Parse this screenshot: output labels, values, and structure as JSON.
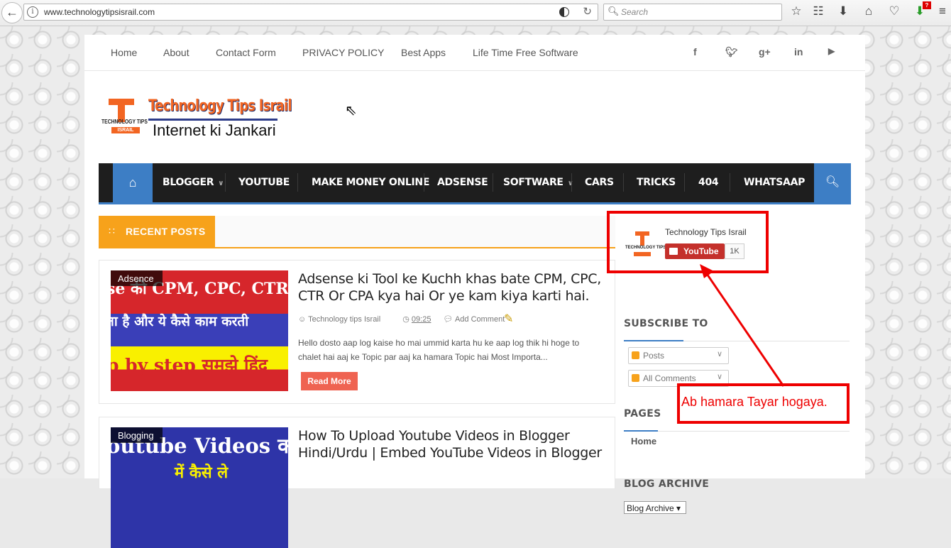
{
  "browser": {
    "url": "www.technologytipsisrail.com",
    "search_placeholder": "Search",
    "notification_badge": "?"
  },
  "topnav": {
    "links": [
      "Home",
      "About",
      "Contact Form",
      "PRIVACY POLICY",
      "Best Apps",
      "Life Time Free Software"
    ],
    "social": [
      "facebook-icon",
      "twitter-icon",
      "google-plus-icon",
      "linkedin-icon",
      "youtube-icon"
    ]
  },
  "logo": {
    "name": "Technology Tips Israil",
    "badge_top": "TECHNOLOGY TIPS",
    "badge_bottom": "ISRAIL",
    "tagline": "Internet ki Jankari"
  },
  "mainnav": {
    "items": [
      "BLOGGER",
      "YOUTUBE",
      "MAKE MONEY ONLINE",
      "ADSENSE",
      "SOFTWARE",
      "CARS",
      "TRICKS",
      "404",
      "WHATSAAP"
    ]
  },
  "recent_posts": {
    "heading": "RECENT POSTS",
    "posts": [
      {
        "category": "Adsence",
        "title": "Adsense ki Tool ke Kuchh khas bate CPM, CPC, CTR Or CPA kya hai Or ye kam kiya karti hai.",
        "author": "Technology tips Israil",
        "time": "09:25",
        "comment": "Add Comment",
        "excerpt": "Hello dosto aap log kaise ho mai ummid karta hu ke aap log thik hi hoge to chalet hai aaj ke Topic par aaj ka hamara Topic hai Most Importa...",
        "read_more": "Read More",
        "thumb_lines": [
          "se की CPM, CPC, CTR और",
          "ता है और ये कैसे काम करती",
          "p by step समझे हिंद"
        ]
      },
      {
        "category": "Blogging",
        "title": "How To Upload Youtube Videos in Blogger Hindi/Urdu | Embed YouTube Videos in Blogger",
        "thumb_lines": [
          "outube Videos क",
          "में कैसे ले"
        ]
      }
    ]
  },
  "sidebar": {
    "youtube": {
      "channel": "Technology Tips Israil",
      "button": "YouTube",
      "count": "1K"
    },
    "subscribe_heading": "SUBSCRIBE TO",
    "feeds": [
      "Posts",
      "All Comments"
    ],
    "pages_heading": "PAGES",
    "pages": [
      "Home"
    ],
    "archive_heading": "BLOG ARCHIVE",
    "archive_select": "Blog Archive"
  },
  "annotation": {
    "note": "Ab hamara Tayar hogaya.",
    "color": "#e00000"
  }
}
